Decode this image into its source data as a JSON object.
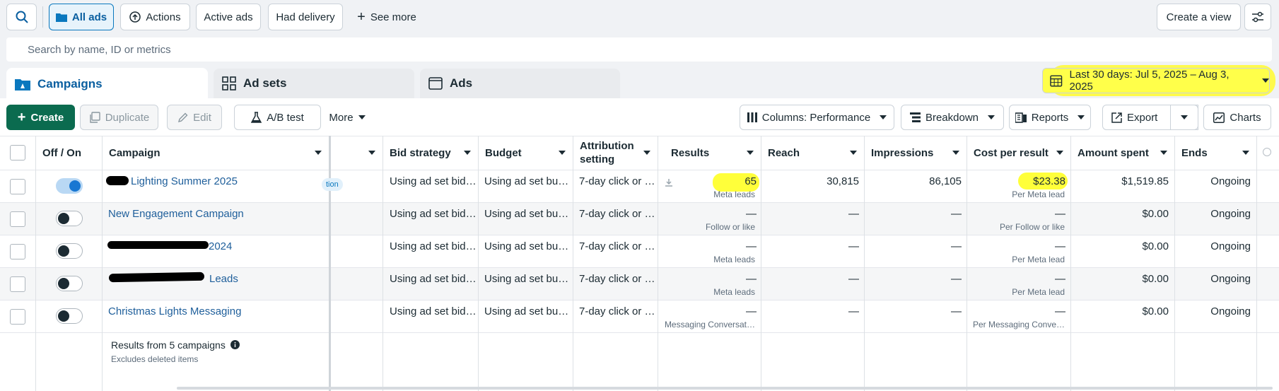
{
  "top": {
    "all_ads": "All ads",
    "actions": "Actions",
    "active_ads": "Active ads",
    "had_delivery": "Had delivery",
    "see_more": "See more",
    "create_view": "Create a view"
  },
  "search": {
    "placeholder": "Search by name, ID or metrics"
  },
  "tabs": {
    "campaigns": "Campaigns",
    "ad_sets": "Ad sets",
    "ads": "Ads"
  },
  "date_range": "Last 30 days: Jul 5, 2025 – Aug 3, 2025",
  "toolbar": {
    "create": "Create",
    "duplicate": "Duplicate",
    "edit": "Edit",
    "ab_test": "A/B test",
    "more": "More",
    "columns": "Columns: Performance",
    "breakdown": "Breakdown",
    "reports": "Reports",
    "export": "Export",
    "charts": "Charts"
  },
  "columns": {
    "off_on": "Off / On",
    "campaign": "Campaign",
    "bid_strategy": "Bid strategy",
    "budget": "Budget",
    "attribution_1": "Attribution",
    "attribution_2": "setting",
    "results": "Results",
    "reach": "Reach",
    "impressions": "Impressions",
    "cost_per_result": "Cost per result",
    "amount_spent": "Amount spent",
    "ends": "Ends"
  },
  "partial_badge": "tion",
  "rows": [
    {
      "name": "Lighting Summer 2025",
      "on": true,
      "bid": "Using ad set bid…",
      "budget": "Using ad set bu…",
      "attribution": "7-day click or …",
      "results": "65",
      "results_sub": "Meta leads",
      "reach": "30,815",
      "impressions": "86,105",
      "cost": "$23.38",
      "cost_sub": "Per Meta lead",
      "spent": "$1,519.85",
      "ends": "Ongoing"
    },
    {
      "name": "New Engagement Campaign",
      "on": false,
      "bid": "Using ad set bid…",
      "budget": "Using ad set bu…",
      "attribution": "7-day click or …",
      "results": "—",
      "results_sub": "Follow or like",
      "reach": "—",
      "impressions": "—",
      "cost": "—",
      "cost_sub": "Per Follow or like",
      "spent": "$0.00",
      "ends": "Ongoing"
    },
    {
      "name": "2024",
      "on": false,
      "bid": "Using ad set bid…",
      "budget": "Using ad set bu…",
      "attribution": "7-day click or …",
      "results": "—",
      "results_sub": "Meta leads",
      "reach": "—",
      "impressions": "—",
      "cost": "—",
      "cost_sub": "Per Meta lead",
      "spent": "$0.00",
      "ends": "Ongoing"
    },
    {
      "name": "Leads",
      "on": false,
      "bid": "Using ad set bid…",
      "budget": "Using ad set bu…",
      "attribution": "7-day click or …",
      "results": "—",
      "results_sub": "Meta leads",
      "reach": "—",
      "impressions": "—",
      "cost": "—",
      "cost_sub": "Per Meta lead",
      "spent": "$0.00",
      "ends": "Ongoing"
    },
    {
      "name": "Christmas Lights Messaging",
      "on": false,
      "bid": "Using ad set bid…",
      "budget": "Using ad set bu…",
      "attribution": "7-day click or …",
      "results": "—",
      "results_sub": "Messaging Conversat…",
      "reach": "—",
      "impressions": "—",
      "cost": "—",
      "cost_sub": "Per Messaging Conve…",
      "spent": "$0.00",
      "ends": "Ongoing"
    }
  ],
  "footer": {
    "results_from": "Results from 5 campaigns",
    "excludes": "Excludes deleted items"
  },
  "colors": {
    "accent": "#0a78be",
    "create_green": "#0b6b4f",
    "highlight": "#ffff3a"
  },
  "icons": [
    "search-icon",
    "folder-icon",
    "upload-circle-icon",
    "settings-sliders-icon",
    "campaigns-icon",
    "ad-sets-icon",
    "ads-icon",
    "calendar-icon",
    "plus-icon",
    "duplicate-icon",
    "pencil-icon",
    "flask-icon",
    "columns-icon",
    "breakdown-icon",
    "reports-icon",
    "export-icon",
    "chart-icon",
    "info-icon",
    "download-icon"
  ]
}
